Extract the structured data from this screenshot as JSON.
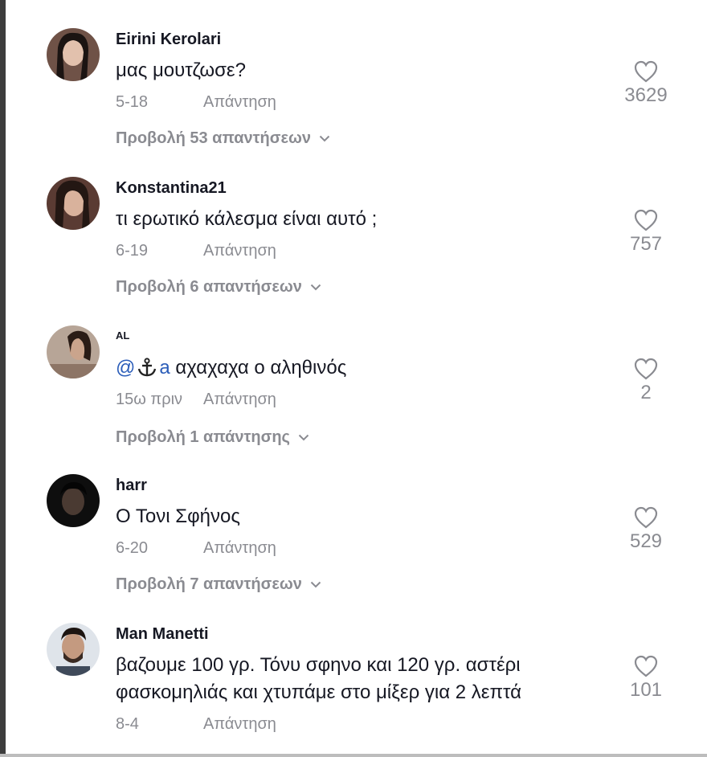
{
  "comments": [
    {
      "username": "Eirini Kerolari",
      "text": "μας μουτζωσε?",
      "date": "5-18",
      "reply_label": "Απάντηση",
      "likes": "3629",
      "view_replies": "Προβολή 53 απαντήσεων"
    },
    {
      "username": "Konstantina21",
      "text": "τι ερωτικό κάλεσμα είναι αυτό ;",
      "date": "6-19",
      "reply_label": "Απάντηση",
      "likes": "757",
      "view_replies": "Προβολή 6 απαντήσεων"
    },
    {
      "username": "AL",
      "mention": "@",
      "mention_name": "a",
      "text": "αχαχαχα ο αληθινός",
      "date": "15ω πριν",
      "reply_label": "Απάντηση",
      "likes": "2",
      "view_replies": "Προβολή 1 απάντησης"
    },
    {
      "username": "harr",
      "text": "Ο Τονι Σφήνος",
      "date": "6-20",
      "reply_label": "Απάντηση",
      "likes": "529",
      "view_replies": "Προβολή 7 απαντήσεων"
    },
    {
      "username": "Man Manetti",
      "text_line1": "βαζουμε 100 γρ. Τόνυ σφηνο και 120 γρ. αστέρι",
      "text_line2": "φασκομηλιάς και χτυπάμε στο μίξερ για 2 λεπτά",
      "date": "8-4",
      "reply_label": "Απάντηση",
      "likes": "101"
    }
  ],
  "icons": {
    "like": "heart-outline-icon",
    "expand": "chevron-down-icon",
    "mention_emoji": "anchor-icon"
  },
  "colors": {
    "text": "#161823",
    "muted": "#8a8b91",
    "mention": "#2b5db9"
  }
}
